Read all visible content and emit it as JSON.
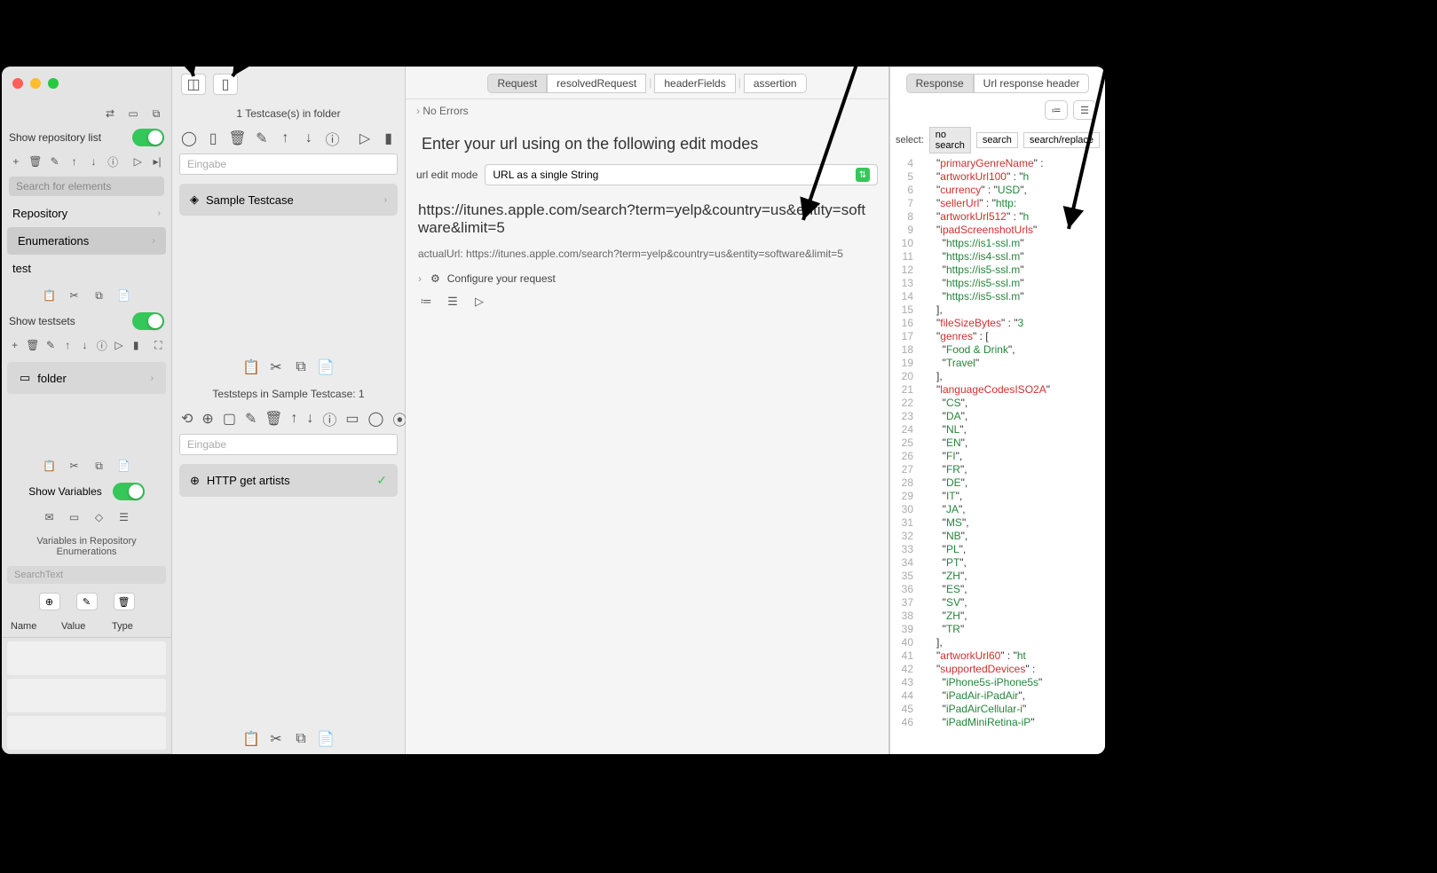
{
  "sidebar": {
    "show_repo_label": "Show repository list",
    "search_placeholder": "Search for elements",
    "items": [
      "Repository",
      "Enumerations",
      "test"
    ],
    "show_testsets_label": "Show testsets",
    "folder_label": "folder",
    "show_variables_label": "Show Variables",
    "variables_in_label": "Variables in  Repository Enumerations",
    "search_text_placeholder": "SearchText",
    "var_cols": [
      "Name",
      "Value",
      "Type"
    ]
  },
  "middle": {
    "testcases_title": "1 Testcase(s) in folder",
    "input_placeholder": "Eingabe",
    "testcase_label": "Sample Testcase",
    "teststeps_title": "Teststeps in Sample Testcase: 1",
    "teststep_label": "HTTP get artists"
  },
  "request": {
    "tabs": [
      "Request",
      "resolvedRequest",
      "headerFields",
      "assertion"
    ],
    "status": "No Errors",
    "heading": "Enter your url using on the following edit modes",
    "mode_label": "url edit mode",
    "mode_value": "URL as a single String",
    "url": "https://itunes.apple.com/search?term=yelp&country=us&entity=software&limit=5",
    "actual_url_label": "actualUrl: https://itunes.apple.com/search?term=yelp&country=us&entity=software&limit=5",
    "configure_label": "Configure your request"
  },
  "response": {
    "tabs": [
      "Response",
      "Url response header"
    ],
    "select_label": "select:",
    "search_segs": [
      "no search",
      "search",
      "search/replace"
    ],
    "code": [
      {
        "n": 4,
        "indent": 3,
        "key": "primaryGenreName",
        "after": " :"
      },
      {
        "n": 5,
        "indent": 3,
        "key": "artworkUrl100",
        "after": " : \"h"
      },
      {
        "n": 6,
        "indent": 3,
        "key": "currency",
        "after": " : ",
        "val": "USD",
        "tail": ","
      },
      {
        "n": 7,
        "indent": 3,
        "key": "sellerUrl",
        "after": " : \"http:"
      },
      {
        "n": 8,
        "indent": 3,
        "key": "artworkUrl512",
        "after": " : \"h"
      },
      {
        "n": 9,
        "indent": 3,
        "key": "ipadScreenshotUrls",
        "after": ""
      },
      {
        "n": 10,
        "indent": 4,
        "str": "https://is1-ssl.m"
      },
      {
        "n": 11,
        "indent": 4,
        "str": "https://is4-ssl.m"
      },
      {
        "n": 12,
        "indent": 4,
        "str": "https://is5-ssl.m"
      },
      {
        "n": 13,
        "indent": 4,
        "str": "https://is5-ssl.m"
      },
      {
        "n": 14,
        "indent": 4,
        "str": "https://is5-ssl.m"
      },
      {
        "n": 15,
        "indent": 3,
        "raw": "],"
      },
      {
        "n": 16,
        "indent": 3,
        "key": "fileSizeBytes",
        "after": " : \"3"
      },
      {
        "n": 17,
        "indent": 3,
        "key": "genres",
        "after": " : ["
      },
      {
        "n": 18,
        "indent": 4,
        "str": "Food & Drink",
        "tail": ","
      },
      {
        "n": 19,
        "indent": 4,
        "str": "Travel"
      },
      {
        "n": 20,
        "indent": 3,
        "raw": "],"
      },
      {
        "n": 21,
        "indent": 3,
        "key": "languageCodesISO2A",
        "after": ""
      },
      {
        "n": 22,
        "indent": 4,
        "str": "CS",
        "tail": ","
      },
      {
        "n": 23,
        "indent": 4,
        "str": "DA",
        "tail": ","
      },
      {
        "n": 24,
        "indent": 4,
        "str": "NL",
        "tail": ","
      },
      {
        "n": 25,
        "indent": 4,
        "str": "EN",
        "tail": ","
      },
      {
        "n": 26,
        "indent": 4,
        "str": "FI",
        "tail": ","
      },
      {
        "n": 27,
        "indent": 4,
        "str": "FR",
        "tail": ","
      },
      {
        "n": 28,
        "indent": 4,
        "str": "DE",
        "tail": ","
      },
      {
        "n": 29,
        "indent": 4,
        "str": "IT",
        "tail": ","
      },
      {
        "n": 30,
        "indent": 4,
        "str": "JA",
        "tail": ","
      },
      {
        "n": 31,
        "indent": 4,
        "str": "MS",
        "tail": ","
      },
      {
        "n": 32,
        "indent": 4,
        "str": "NB",
        "tail": ","
      },
      {
        "n": 33,
        "indent": 4,
        "str": "PL",
        "tail": ","
      },
      {
        "n": 34,
        "indent": 4,
        "str": "PT",
        "tail": ","
      },
      {
        "n": 35,
        "indent": 4,
        "str": "ZH",
        "tail": ","
      },
      {
        "n": 36,
        "indent": 4,
        "str": "ES",
        "tail": ","
      },
      {
        "n": 37,
        "indent": 4,
        "str": "SV",
        "tail": ","
      },
      {
        "n": 38,
        "indent": 4,
        "str": "ZH",
        "tail": ","
      },
      {
        "n": 39,
        "indent": 4,
        "str": "TR"
      },
      {
        "n": 40,
        "indent": 3,
        "raw": "],"
      },
      {
        "n": 41,
        "indent": 3,
        "key": "artworkUrl60",
        "after": " : \"ht"
      },
      {
        "n": 42,
        "indent": 3,
        "key": "supportedDevices",
        "after": " :"
      },
      {
        "n": 43,
        "indent": 4,
        "str": "iPhone5s-iPhone5s"
      },
      {
        "n": 44,
        "indent": 4,
        "str": "iPadAir-iPadAir",
        "tail": ","
      },
      {
        "n": 45,
        "indent": 4,
        "str": "iPadAirCellular-i"
      },
      {
        "n": 46,
        "indent": 4,
        "str": "iPadMiniRetina-iP"
      }
    ]
  }
}
